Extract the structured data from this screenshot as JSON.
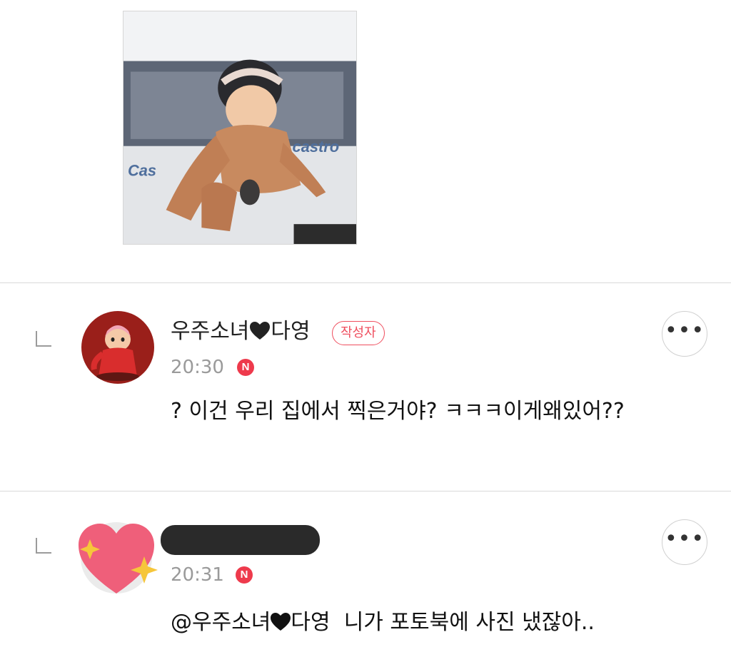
{
  "post": {
    "photo_icon": "photo-image"
  },
  "comments": [
    {
      "author_name_part1": "우주소녀",
      "author_name_part2": "다영",
      "author_badge": "작성자",
      "time": "20:30",
      "new_label": "N",
      "more_label": "•••",
      "text": "? 이건 우리 집에서 찍은거야? ㅋㅋㅋ이게왜있어??"
    },
    {
      "author_name": "",
      "time": "20:31",
      "new_label": "N",
      "more_label": "•••",
      "mention_part1": "@우주소녀",
      "mention_part2": "다영",
      "text": "니가 포토북에 사진 냈잖아.."
    }
  ],
  "colors": {
    "accent": "#ef4e5e",
    "new_badge": "#ee3a4c",
    "heart_avatar": "#ef5f7a",
    "star": "#f6c63a"
  }
}
